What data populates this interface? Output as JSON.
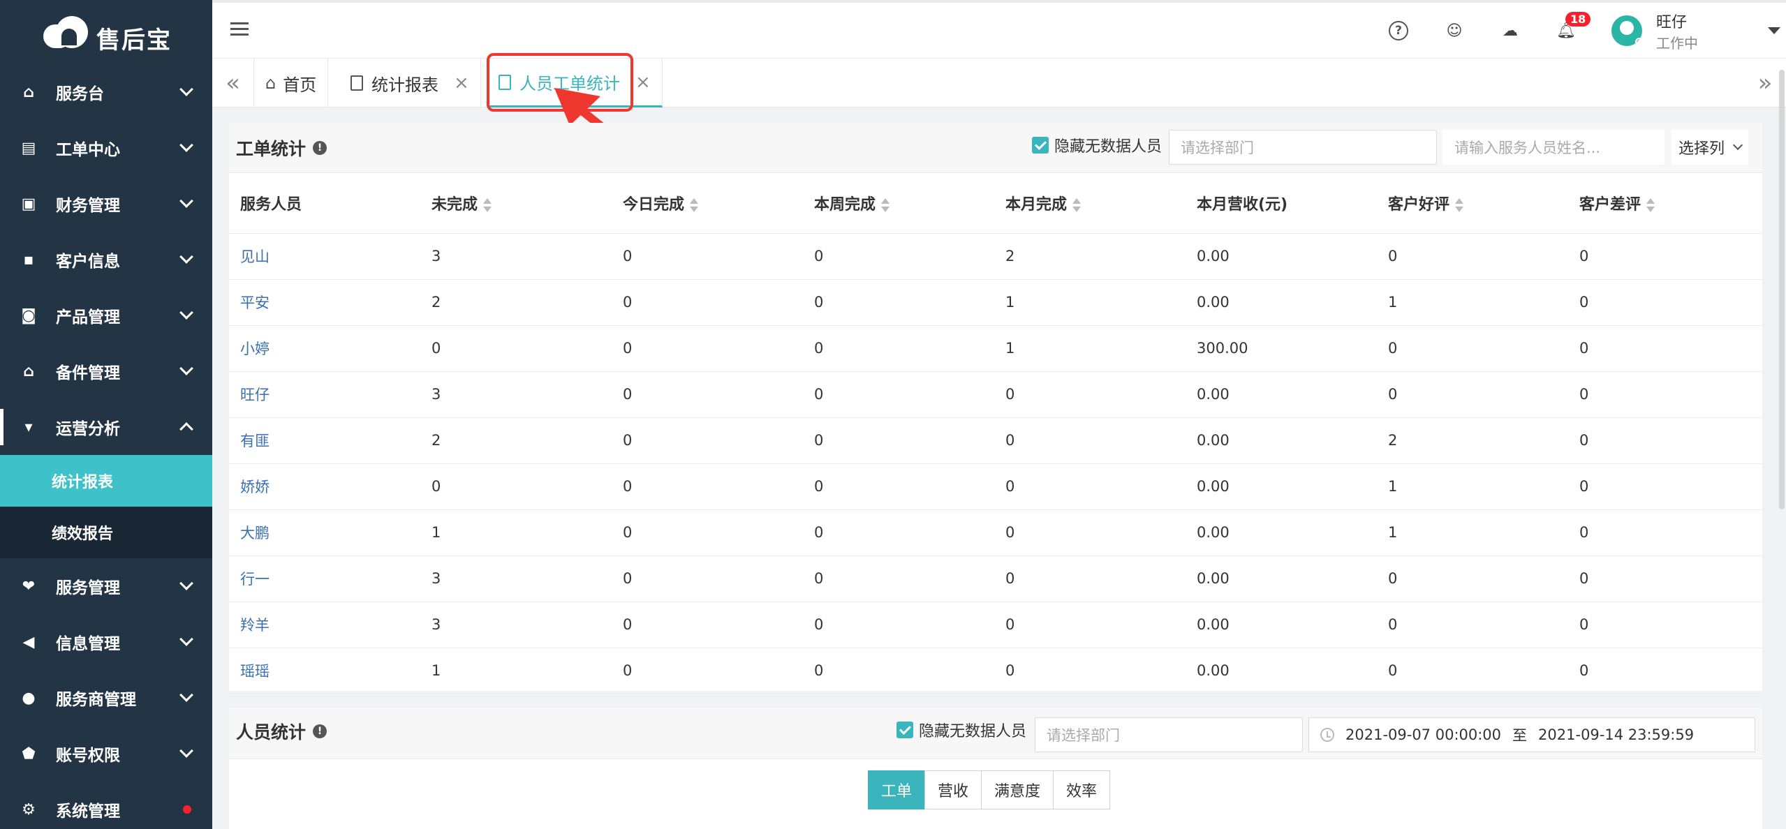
{
  "app": {
    "logo_text": "售后宝"
  },
  "sidebar": {
    "items": [
      {
        "label": "服务台",
        "icon": "home-icon"
      },
      {
        "label": "工单中心",
        "icon": "clipboard-icon"
      },
      {
        "label": "财务管理",
        "icon": "wallet-icon"
      },
      {
        "label": "客户信息",
        "icon": "contact-card-icon"
      },
      {
        "label": "产品管理",
        "icon": "product-icon"
      },
      {
        "label": "备件管理",
        "icon": "warehouse-icon"
      },
      {
        "label": "运营分析",
        "icon": "analytics-icon"
      },
      {
        "label": "服务管理",
        "icon": "handshake-icon"
      },
      {
        "label": "信息管理",
        "icon": "megaphone-icon"
      },
      {
        "label": "服务商管理",
        "icon": "people-icon"
      },
      {
        "label": "账号权限",
        "icon": "shield-icon"
      },
      {
        "label": "系统管理",
        "icon": "gear-icon"
      }
    ],
    "subitems": [
      {
        "label": "统计报表"
      },
      {
        "label": "绩效报告"
      }
    ]
  },
  "topbar": {
    "notification_count": "18",
    "user_name": "旺仔",
    "user_status": "工作中"
  },
  "tabs": [
    {
      "label": "首页"
    },
    {
      "label": "统计报表",
      "close": "×"
    },
    {
      "label": "人员工单统计",
      "close": "×"
    }
  ],
  "workorder_panel": {
    "title": "工单统计",
    "hide_empty_label": "隐藏无数据人员",
    "dept_placeholder": "请选择部门",
    "name_placeholder": "请输入服务人员姓名...",
    "select_columns_label": "选择列",
    "columns": [
      "服务人员",
      "未完成",
      "今日完成",
      "本周完成",
      "本月完成",
      "本月营收(元)",
      "客户好评",
      "客户差评"
    ],
    "rows": [
      [
        "见山",
        "3",
        "0",
        "0",
        "2",
        "0.00",
        "0",
        "0"
      ],
      [
        "平安",
        "2",
        "0",
        "0",
        "1",
        "0.00",
        "1",
        "0"
      ],
      [
        "小婷",
        "0",
        "0",
        "0",
        "1",
        "300.00",
        "0",
        "0"
      ],
      [
        "旺仔",
        "3",
        "0",
        "0",
        "0",
        "0.00",
        "0",
        "0"
      ],
      [
        "有匪",
        "2",
        "0",
        "0",
        "0",
        "0.00",
        "2",
        "0"
      ],
      [
        "娇娇",
        "0",
        "0",
        "0",
        "0",
        "0.00",
        "1",
        "0"
      ],
      [
        "大鹏",
        "1",
        "0",
        "0",
        "0",
        "0.00",
        "1",
        "0"
      ],
      [
        "行一",
        "3",
        "0",
        "0",
        "0",
        "0.00",
        "0",
        "0"
      ],
      [
        "羚羊",
        "3",
        "0",
        "0",
        "0",
        "0.00",
        "0",
        "0"
      ],
      [
        "瑶瑶",
        "1",
        "0",
        "0",
        "0",
        "0.00",
        "0",
        "0"
      ]
    ]
  },
  "staff_panel": {
    "title": "人员统计",
    "hide_empty_label": "隐藏无数据人员",
    "dept_placeholder": "请选择部门",
    "date_start": "2021-09-07 00:00:00",
    "date_sep": "至",
    "date_end": "2021-09-14 23:59:59",
    "buttons": [
      "工单",
      "营收",
      "满意度",
      "效率"
    ]
  },
  "colors": {
    "accent": "#3ab5bd",
    "sidebar_bg": "#233445",
    "highlight": "#f0372f"
  }
}
